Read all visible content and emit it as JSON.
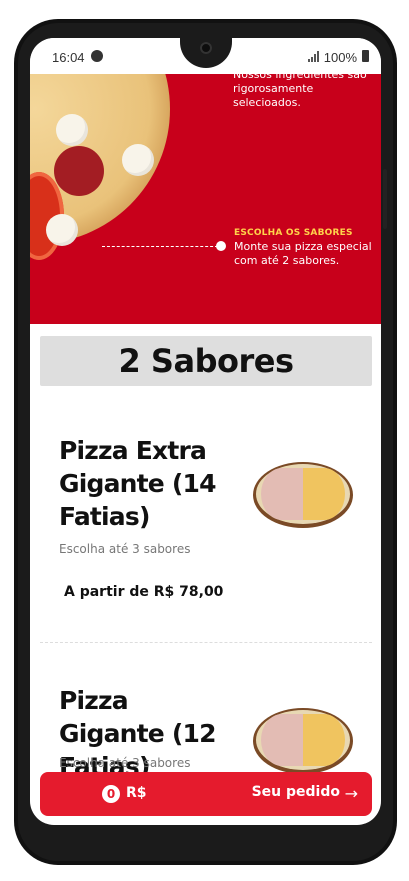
{
  "status_bar": {
    "time": "16:04",
    "battery": "100%"
  },
  "hero": {
    "text1": "Nossos ingredientes são rigorosamente selecioados.",
    "step_title": "ESCOLHA OS SABORES",
    "step_text": "Monte sua pizza especial com até 2 sabores."
  },
  "section": {
    "title": "2 Sabores"
  },
  "products": [
    {
      "name": "Pizza Extra Gigante (14 Fatias)",
      "desc": "Escolha até 3 sabores",
      "price": "A partir de R$ 78,00"
    },
    {
      "name": "Pizza Gigante (12 Fatias)",
      "desc": "Escolha até 3 sabores"
    }
  ],
  "order_bar": {
    "count": "0",
    "currency": "R$",
    "label": "Seu pedido",
    "arrow": "→"
  },
  "colors": {
    "brand_red": "#c8001b",
    "button_red": "#e51b2d",
    "accent_yellow": "#ffd34b"
  }
}
